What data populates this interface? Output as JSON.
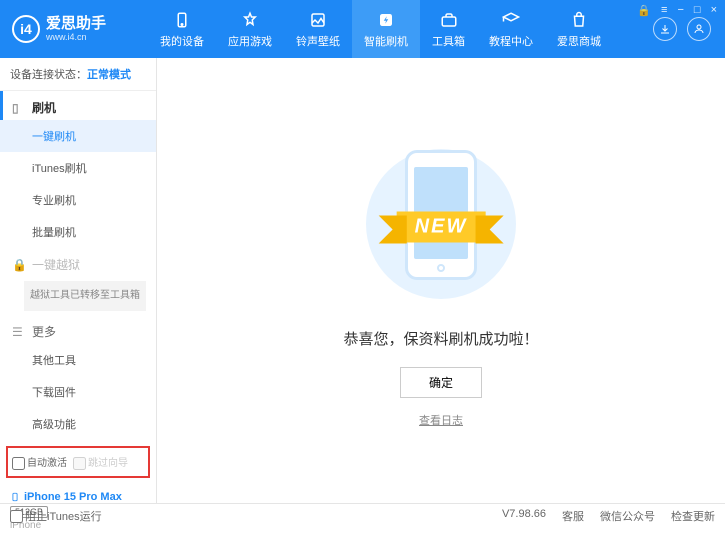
{
  "app": {
    "name": "爱思助手",
    "url": "www.i4.cn"
  },
  "nav": [
    {
      "label": "我的设备"
    },
    {
      "label": "应用游戏"
    },
    {
      "label": "铃声壁纸"
    },
    {
      "label": "智能刷机"
    },
    {
      "label": "工具箱"
    },
    {
      "label": "教程中心"
    },
    {
      "label": "爱思商城"
    }
  ],
  "status": {
    "label": "设备连接状态：",
    "value": "正常模式"
  },
  "sidebar": {
    "flash_section": "刷机",
    "items": {
      "one_click": "一键刷机",
      "itunes": "iTunes刷机",
      "pro": "专业刷机",
      "batch": "批量刷机"
    },
    "jailbreak_section": "一键越狱",
    "jailbreak_note": "越狱工具已转移至工具箱",
    "more_section": "更多",
    "more": {
      "other_tools": "其他工具",
      "download_fw": "下载固件",
      "advanced": "高级功能"
    },
    "checkboxes": {
      "auto_activate": "自动激活",
      "skip_guide": "跳过向导"
    }
  },
  "device": {
    "name": "iPhone 15 Pro Max",
    "storage": "512GB",
    "type": "iPhone"
  },
  "main": {
    "ribbon": "NEW",
    "success": "恭喜您，保资料刷机成功啦！",
    "ok": "确定",
    "view_log": "查看日志"
  },
  "footer": {
    "block_itunes": "阻止iTunes运行",
    "version": "V7.98.66",
    "links": {
      "service": "客服",
      "wechat": "微信公众号",
      "update": "检查更新"
    }
  }
}
